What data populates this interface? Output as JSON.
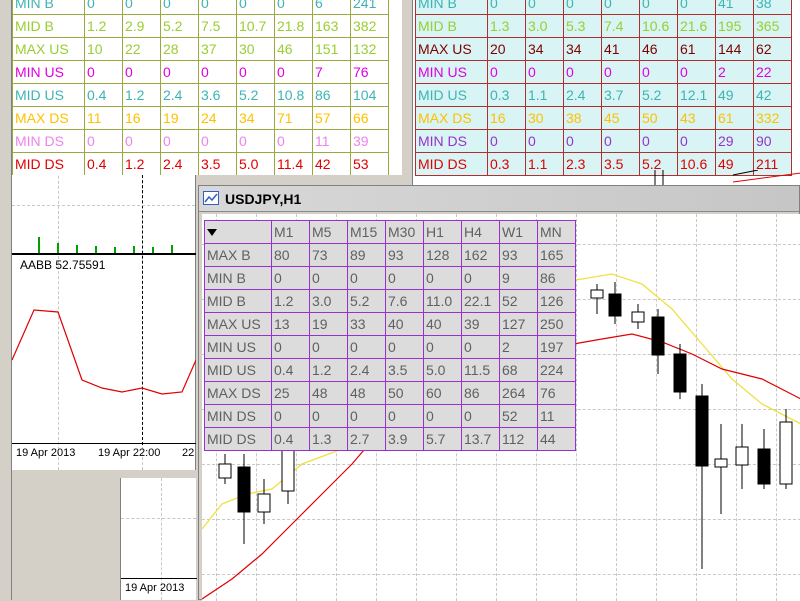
{
  "top_left_table": {
    "colors": {
      "grid": "#9aa840",
      "bg": "#ffffff"
    },
    "rows": [
      {
        "label": "MIN B",
        "color": "#3cb4b4",
        "values": [
          "0",
          "0",
          "0",
          "0",
          "0",
          "0",
          "6",
          "241"
        ]
      },
      {
        "label": "MID B",
        "color": "#9acd32",
        "values": [
          "1.2",
          "2.9",
          "5.2",
          "7.5",
          "10.7",
          "21.8",
          "163",
          "382"
        ]
      },
      {
        "label": "MAX US",
        "color": "#9acd32",
        "values": [
          "10",
          "22",
          "28",
          "37",
          "30",
          "46",
          "151",
          "132"
        ]
      },
      {
        "label": "MIN US",
        "color": "#e000e0",
        "values": [
          "0",
          "0",
          "0",
          "0",
          "0",
          "0",
          "7",
          "76"
        ]
      },
      {
        "label": "MID US",
        "color": "#3cb4b4",
        "values": [
          "0.4",
          "1.2",
          "2.4",
          "3.6",
          "5.2",
          "10.8",
          "86",
          "104"
        ]
      },
      {
        "label": "MAX DS",
        "color": "#ffc000",
        "values": [
          "11",
          "16",
          "19",
          "24",
          "34",
          "71",
          "57",
          "66"
        ]
      },
      {
        "label": "MIN DS",
        "color": "#ee82ee",
        "values": [
          "0",
          "0",
          "0",
          "0",
          "0",
          "0",
          "11",
          "39"
        ]
      },
      {
        "label": "MID DS",
        "color": "#e00000",
        "values": [
          "0.4",
          "1.2",
          "2.4",
          "3.5",
          "5.0",
          "11.4",
          "42",
          "53"
        ]
      }
    ]
  },
  "top_right_table": {
    "colors": {
      "grid": "#b03030",
      "bg": "#d8f4f4"
    },
    "rows": [
      {
        "label": "MIN B",
        "color": "#3cb4b4",
        "values": [
          "0",
          "0",
          "0",
          "0",
          "0",
          "0",
          "41",
          "38"
        ]
      },
      {
        "label": "MID B",
        "color": "#9acd32",
        "values": [
          "1.3",
          "3.0",
          "5.3",
          "7.4",
          "10.6",
          "21.6",
          "195",
          "365"
        ]
      },
      {
        "label": "MAX US",
        "color": "#800000",
        "values": [
          "20",
          "34",
          "34",
          "41",
          "46",
          "61",
          "144",
          "62"
        ]
      },
      {
        "label": "MIN US",
        "color": "#e000e0",
        "values": [
          "0",
          "0",
          "0",
          "0",
          "0",
          "0",
          "2",
          "22"
        ]
      },
      {
        "label": "MID US",
        "color": "#3cb4b4",
        "values": [
          "0.3",
          "1.1",
          "2.4",
          "3.7",
          "5.2",
          "12.1",
          "49",
          "42"
        ]
      },
      {
        "label": "MAX DS",
        "color": "#ffc000",
        "values": [
          "16",
          "30",
          "38",
          "45",
          "50",
          "43",
          "61",
          "332"
        ]
      },
      {
        "label": "MIN DS",
        "color": "#9932cc",
        "values": [
          "0",
          "0",
          "0",
          "0",
          "0",
          "0",
          "29",
          "90"
        ]
      },
      {
        "label": "MID DS",
        "color": "#e00000",
        "values": [
          "0.3",
          "1.1",
          "2.3",
          "3.5",
          "5.2",
          "10.6",
          "49",
          "211"
        ]
      }
    ]
  },
  "left_chart": {
    "indicator_label": "AABB 52.75591",
    "time_labels": [
      "19 Apr 2013",
      "19 Apr 22:00",
      "22"
    ],
    "bottom_time_label": "19 Apr 2013"
  },
  "usdjpy_window": {
    "title": "USDJPY,H1",
    "table": {
      "colors": {
        "grid": "#9932cc",
        "bg": "#dcdcdc",
        "text": "#606060"
      },
      "corner_icon": "triangle-down-icon",
      "headers": [
        "M1",
        "M5",
        "M15",
        "M30",
        "H1",
        "H4",
        "W1",
        "MN"
      ],
      "rows": [
        {
          "label": "MAX B",
          "values": [
            "80",
            "73",
            "89",
            "93",
            "128",
            "162",
            "93",
            "165"
          ]
        },
        {
          "label": "MIN B",
          "values": [
            "0",
            "0",
            "0",
            "0",
            "0",
            "0",
            "9",
            "86"
          ]
        },
        {
          "label": "MID B",
          "values": [
            "1.2",
            "3.0",
            "5.2",
            "7.6",
            "11.0",
            "22.1",
            "52",
            "126"
          ]
        },
        {
          "label": "MAX US",
          "values": [
            "13",
            "19",
            "33",
            "40",
            "40",
            "39",
            "127",
            "250"
          ]
        },
        {
          "label": "MIN US",
          "values": [
            "0",
            "0",
            "0",
            "0",
            "0",
            "0",
            "2",
            "197"
          ]
        },
        {
          "label": "MID US",
          "values": [
            "0.4",
            "1.2",
            "2.4",
            "3.5",
            "5.0",
            "11.5",
            "68",
            "224"
          ]
        },
        {
          "label": "MAX DS",
          "values": [
            "25",
            "48",
            "48",
            "50",
            "60",
            "86",
            "264",
            "76"
          ]
        },
        {
          "label": "MIN DS",
          "values": [
            "0",
            "0",
            "0",
            "0",
            "0",
            "0",
            "52",
            "11"
          ]
        },
        {
          "label": "MID DS",
          "values": [
            "0.4",
            "1.3",
            "2.7",
            "3.9",
            "5.7",
            "13.7",
            "112",
            "44"
          ]
        }
      ]
    }
  }
}
